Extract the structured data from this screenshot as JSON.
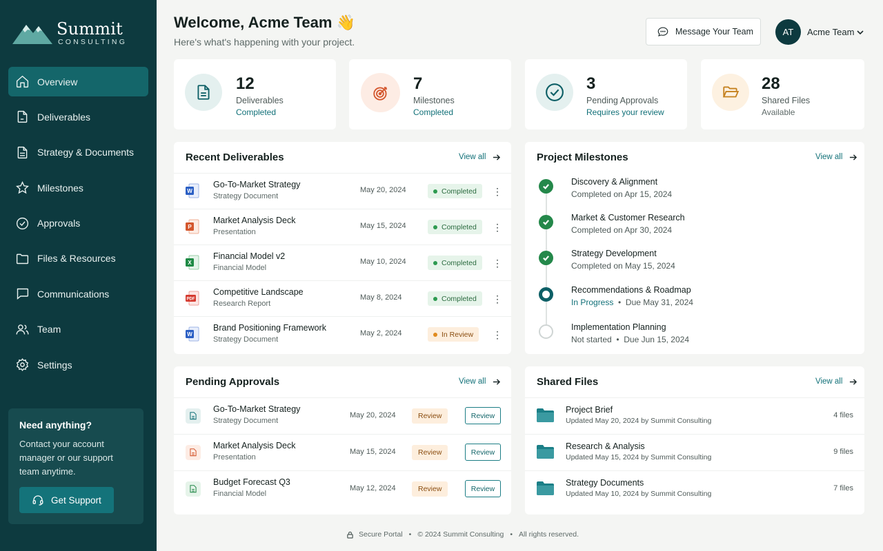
{
  "brand": {
    "name": "Summit",
    "subtitle": "CONSULTING"
  },
  "sidebar": {
    "items": [
      {
        "label": "Overview",
        "icon": "home-icon",
        "active": true
      },
      {
        "label": "Deliverables",
        "icon": "file-icon"
      },
      {
        "label": "Strategy & Documents",
        "icon": "document-icon"
      },
      {
        "label": "Milestones",
        "icon": "star-icon"
      },
      {
        "label": "Approvals",
        "icon": "check-circle-icon"
      },
      {
        "label": "Files & Resources",
        "icon": "folder-icon"
      },
      {
        "label": "Communications",
        "icon": "chat-icon"
      },
      {
        "label": "Team",
        "icon": "users-icon"
      },
      {
        "label": "Settings",
        "icon": "gear-icon"
      }
    ],
    "help": {
      "title": "Need anything?",
      "text": "Contact your account manager or our support team anytime.",
      "button": "Get Support"
    }
  },
  "header": {
    "welcome": "Welcome, Acme Team 👋",
    "subtitle": "Here's what's happening with your project.",
    "message_button": "Message Your Team",
    "avatar_initials": "AT",
    "user_name": "Acme Team"
  },
  "stats": [
    {
      "value": "12",
      "label": "Deliverables",
      "sub": "Completed",
      "icon": "document-icon",
      "color": "#0d5f66",
      "bg": "#e4f0ef"
    },
    {
      "value": "7",
      "label": "Milestones",
      "sub": "Completed",
      "icon": "target-icon",
      "color": "#d4572e",
      "bg": "#fdece4"
    },
    {
      "value": "3",
      "label": "Pending Approvals",
      "sub": "Requires your review",
      "icon": "check-circle-icon",
      "color": "#0d5f66",
      "bg": "#e4f0ef"
    },
    {
      "value": "28",
      "label": "Shared Files",
      "sub": "Available",
      "icon": "folder-open-icon",
      "color": "#c5811f",
      "bg": "#fdf1e1"
    }
  ],
  "deliverables": {
    "title": "Recent Deliverables",
    "view_all": "View all",
    "rows": [
      {
        "title": "Go-To-Market Strategy",
        "type": "Strategy Document",
        "date": "May 20, 2024",
        "status": "Completed",
        "file": "word"
      },
      {
        "title": "Market Analysis Deck",
        "type": "Presentation",
        "date": "May 15, 2024",
        "status": "Completed",
        "file": "powerpoint"
      },
      {
        "title": "Financial Model v2",
        "type": "Financial Model",
        "date": "May 10, 2024",
        "status": "Completed",
        "file": "excel"
      },
      {
        "title": "Competitive Landscape",
        "type": "Research Report",
        "date": "May 8, 2024",
        "status": "Completed",
        "file": "pdf"
      },
      {
        "title": "Brand Positioning Framework",
        "type": "Strategy Document",
        "date": "May 2, 2024",
        "status": "In Review",
        "file": "word"
      }
    ]
  },
  "milestones": {
    "title": "Project Milestones",
    "view_all": "View all",
    "items": [
      {
        "title": "Discovery & Alignment",
        "status_text": "Completed on Apr 15, 2024",
        "state": "done"
      },
      {
        "title": "Market & Customer Research",
        "status_text": "Completed on Apr 30, 2024",
        "state": "done"
      },
      {
        "title": "Strategy Development",
        "status_text": "Completed on May 15, 2024",
        "state": "done"
      },
      {
        "title": "Recommendations & Roadmap",
        "status_text": "In Progress",
        "due": "Due May 31, 2024",
        "state": "progress"
      },
      {
        "title": "Implementation Planning",
        "status_text": "Not started",
        "due": "Due Jun 15, 2024",
        "state": "todo"
      }
    ]
  },
  "approvals": {
    "title": "Pending Approvals",
    "view_all": "View all",
    "rows": [
      {
        "title": "Go-To-Market Strategy",
        "type": "Strategy Document",
        "date": "May 20, 2024",
        "badge": "Review",
        "button": "Review",
        "color": "#117078",
        "bg": "#e4f0ef"
      },
      {
        "title": "Market Analysis Deck",
        "type": "Presentation",
        "date": "May 15, 2024",
        "badge": "Review",
        "button": "Review",
        "color": "#d4572e",
        "bg": "#fdece4"
      },
      {
        "title": "Budget Forecast Q3",
        "type": "Financial Model",
        "date": "May 12, 2024",
        "badge": "Review",
        "button": "Review",
        "color": "#24884a",
        "bg": "#e6f4ea"
      }
    ]
  },
  "files": {
    "title": "Shared Files",
    "view_all": "View all",
    "rows": [
      {
        "title": "Project Brief",
        "updated": "Updated May 20, 2024 by Summit Consulting",
        "count": "4 files"
      },
      {
        "title": "Research & Analysis",
        "updated": "Updated May 15, 2024 by Summit Consulting",
        "count": "9 files"
      },
      {
        "title": "Strategy Documents",
        "updated": "Updated May 10, 2024 by Summit Consulting",
        "count": "7 files"
      }
    ]
  },
  "footer": {
    "secure": "Secure Portal",
    "copyright": "© 2024 Summit Consulting",
    "rights": "All rights reserved."
  },
  "colors": {
    "sidebar": "#0d3a3f",
    "accent": "#14666a",
    "success": "#24884a",
    "warning": "#e08a1e"
  }
}
